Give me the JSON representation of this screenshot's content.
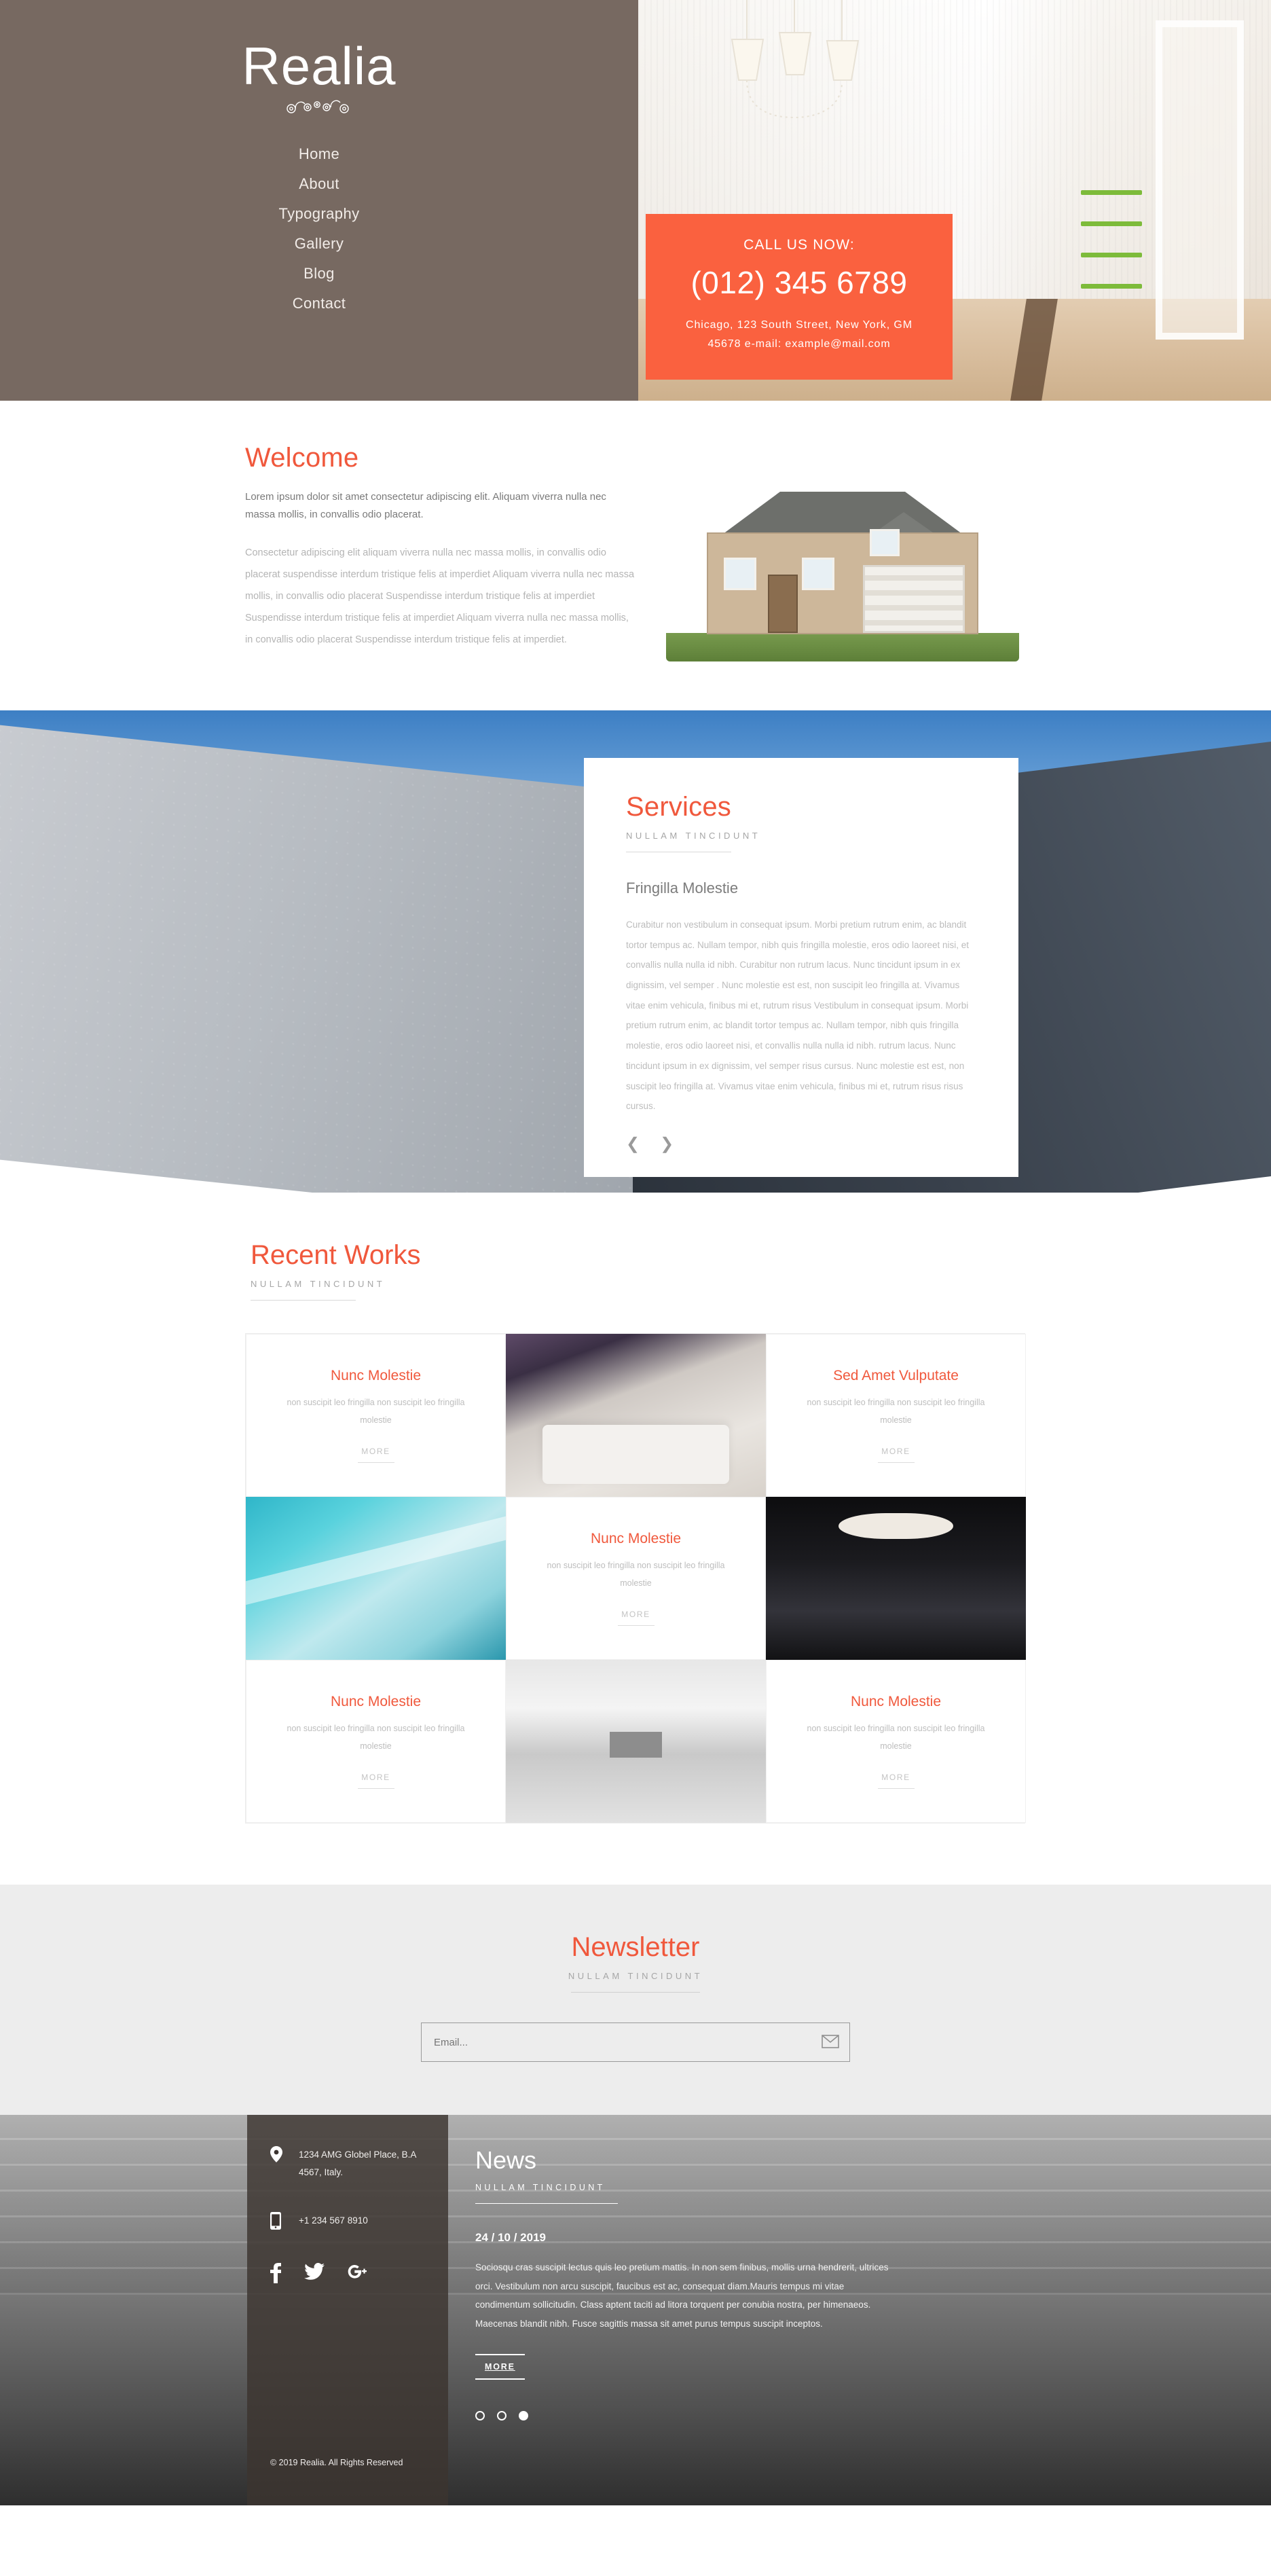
{
  "brand": {
    "name": "Realia",
    "flourish_icon": "ornamental-flourish-icon"
  },
  "nav": {
    "items": [
      {
        "label": "Home"
      },
      {
        "label": "About"
      },
      {
        "label": "Typography"
      },
      {
        "label": "Gallery"
      },
      {
        "label": "Blog"
      },
      {
        "label": "Contact"
      }
    ]
  },
  "hero": {
    "call_label": "CALL US NOW:",
    "phone": "(012) 345 6789",
    "address_line1": "Chicago, 123 South Street, New York, GM",
    "address_line2": "45678 e-mail: example@mail.com"
  },
  "welcome": {
    "title": "Welcome",
    "lead": "Lorem ipsum dolor sit amet consectetur adipiscing elit. Aliquam viverra nulla nec massa mollis, in convallis odio placerat.",
    "body": "Consectetur adipiscing elit aliquam viverra nulla nec massa mollis, in convallis odio placerat suspendisse interdum tristique felis at imperdiet Aliquam viverra nulla nec massa mollis, in convallis odio placerat Suspendisse interdum tristique felis at imperdiet Suspendisse interdum tristique felis at imperdiet Aliquam viverra nulla nec massa mollis, in convallis odio placerat Suspendisse interdum tristique felis at imperdiet."
  },
  "services": {
    "title": "Services",
    "kicker": "NULLAM TINCIDUNT",
    "subtitle": "Fringilla Molestie",
    "body": "Curabitur non vestibulum in consequat ipsum. Morbi pretium rutrum enim, ac blandit tortor tempus ac. Nullam tempor, nibh quis fringilla molestie, eros odio laoreet nisi, et convallis nulla nulla id nibh. Curabitur non rutrum lacus. Nunc tincidunt ipsum in ex dignissim, vel semper . Nunc molestie est est, non suscipit leo fringilla at. Vivamus vitae enim vehicula, finibus mi et, rutrum risus Vestibulum in consequat ipsum. Morbi pretium rutrum enim, ac blandit tortor tempus ac. Nullam tempor, nibh quis fringilla molestie, eros odio laoreet nisi, et convallis nulla nulla id nibh. rutrum lacus. Nunc tincidunt ipsum in ex dignissim, vel semper risus cursus. Nunc molestie est est, non suscipit leo fringilla at. Vivamus vitae enim vehicula, finibus mi et, rutrum risus risus cursus.",
    "prev_icon": "chevron-left-icon",
    "next_icon": "chevron-right-icon"
  },
  "works": {
    "title": "Recent Works",
    "kicker": "NULLAM TINCIDUNT",
    "cells": [
      {
        "kind": "text",
        "title": "Nunc Molestie",
        "desc": "non suscipit leo fringilla non suscipit leo fringilla molestie",
        "more": "MORE"
      },
      {
        "kind": "image",
        "image": "lounge-interior-photo"
      },
      {
        "kind": "text",
        "title": "Sed Amet Vulputate",
        "desc": "non suscipit leo fringilla non suscipit leo fringilla molestie",
        "more": "MORE"
      },
      {
        "kind": "image",
        "image": "pool-ceiling-photo"
      },
      {
        "kind": "text",
        "title": "Nunc Molestie",
        "desc": "non suscipit leo fringilla non suscipit leo fringilla molestie",
        "more": "MORE"
      },
      {
        "kind": "image",
        "image": "dark-office-lobby-photo"
      },
      {
        "kind": "text",
        "title": "Nunc Molestie",
        "desc": "non suscipit leo fringilla non suscipit leo fringilla molestie",
        "more": "MORE"
      },
      {
        "kind": "image",
        "image": "white-corridor-photo"
      },
      {
        "kind": "text",
        "title": "Nunc Molestie",
        "desc": "non suscipit leo fringilla non suscipit leo fringilla molestie",
        "more": "MORE"
      }
    ]
  },
  "newsletter": {
    "title": "Newsletter",
    "kicker": "NULLAM TINCIDUNT",
    "placeholder": "Email...",
    "value": "",
    "submit_icon": "envelope-icon"
  },
  "footer": {
    "address_icon": "map-pin-icon",
    "address_line1": "1234 AMG Globel Place, B.A",
    "address_line2": "4567, Italy.",
    "phone_icon": "mobile-phone-icon",
    "phone": "+1 234 567 8910",
    "socials": [
      {
        "name": "facebook-icon",
        "glyph": "f"
      },
      {
        "name": "twitter-icon",
        "glyph": "ᵗ"
      },
      {
        "name": "google-plus-icon",
        "glyph": "g+"
      }
    ],
    "copyright": "© 2019 Realia. All Rights Reserved",
    "news": {
      "title": "News",
      "kicker": "NULLAM TINCIDUNT",
      "date": "24 / 10 / 2019",
      "body": "Sociosqu cras suscipit lectus quis leo pretium mattis. In non sem finibus, mollis urna hendrerit, ultrices orci. Vestibulum non arcu suscipit, faucibus est ac, consequat diam.Mauris tempus mi vitae condimentum sollicitudin. Class aptent taciti ad litora torquent per conubia nostra, per himenaeos. Maecenas blandit nibh. Fusce sagittis massa sit amet purus tempus suscipit inceptos.",
      "more": "MORE",
      "dots": 3,
      "active_dot": 3
    }
  },
  "colors": {
    "accent": "#f0583c",
    "hero_bg": "#776961",
    "call_box": "#fa613f",
    "newsletter_bg": "#ededed"
  }
}
